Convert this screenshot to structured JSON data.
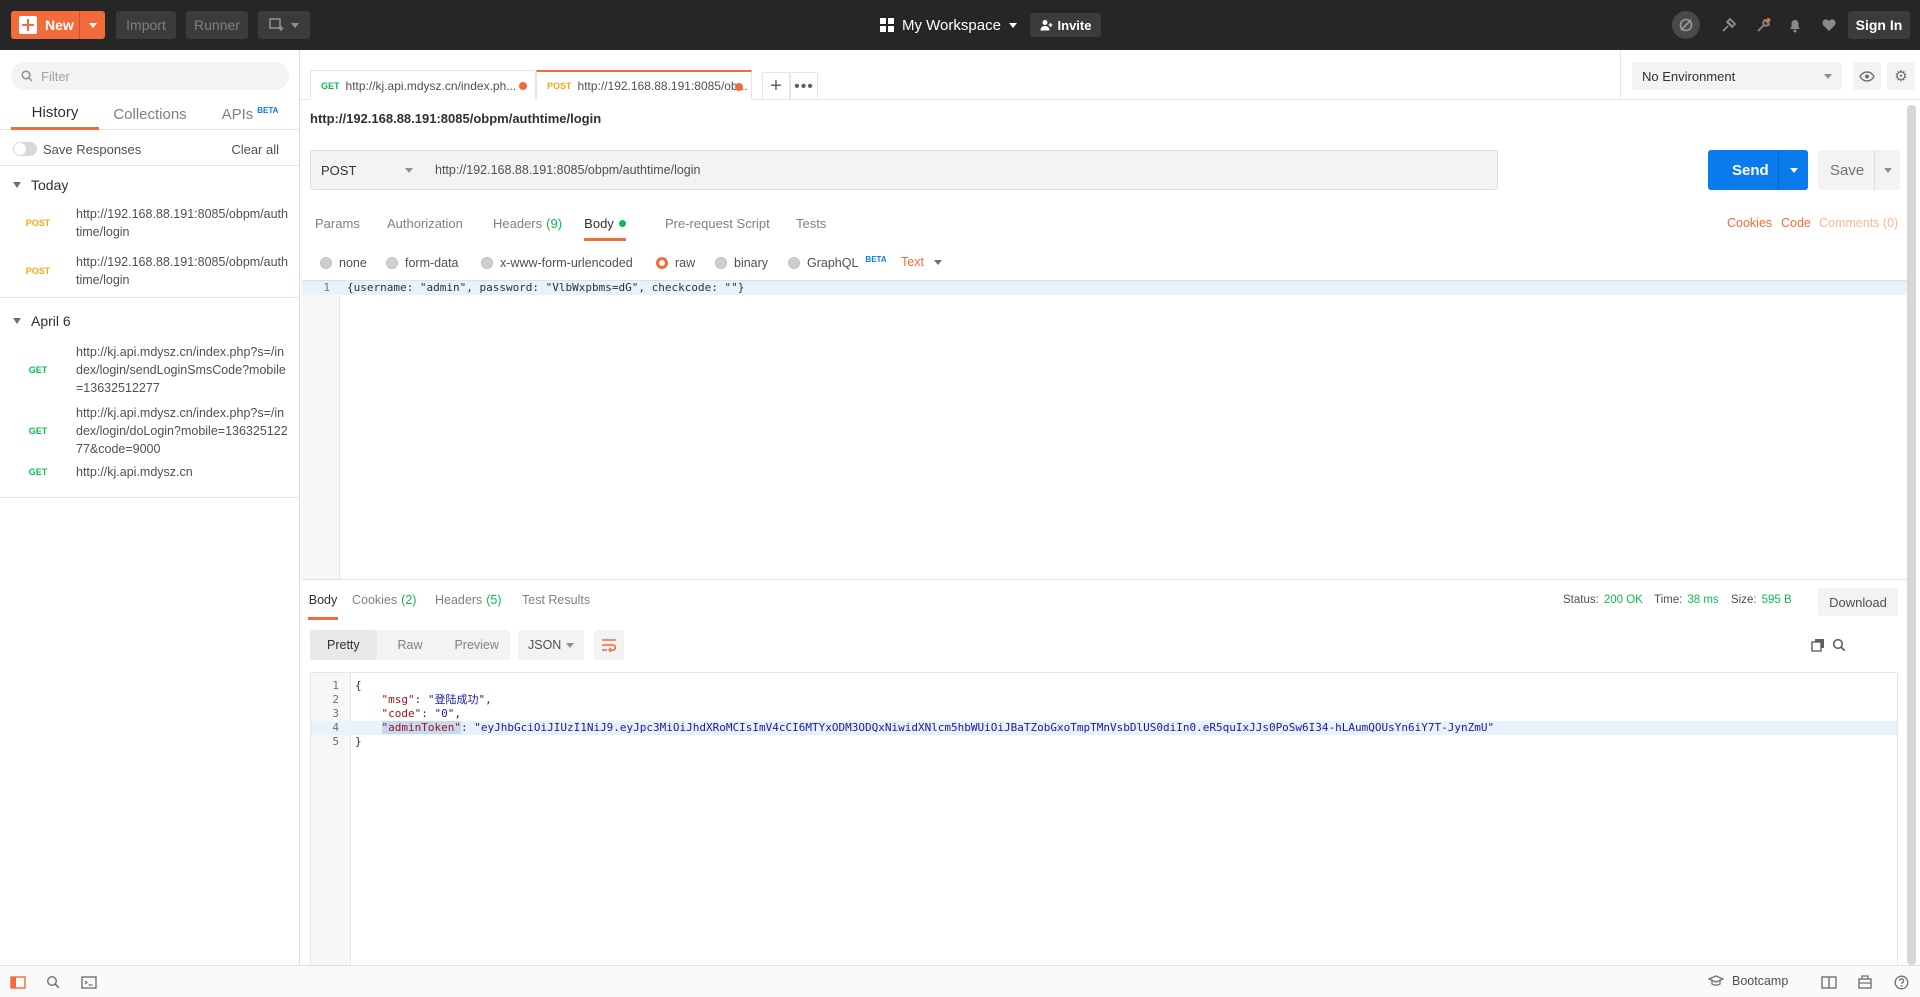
{
  "topbar": {
    "new_label": "New",
    "import_label": "Import",
    "runner_label": "Runner",
    "workspace_label": "My Workspace",
    "invite_label": "Invite",
    "signin_label": "Sign In"
  },
  "sidebar": {
    "filter_placeholder": "Filter",
    "tabs": [
      {
        "label": "History"
      },
      {
        "label": "Collections"
      },
      {
        "label": "APIs",
        "badge": "BETA"
      }
    ],
    "save_responses_label": "Save Responses",
    "clear_all_label": "Clear all",
    "groups": [
      {
        "label": "Today",
        "items": [
          {
            "method": "POST",
            "url": "http://192.168.88.191:8085/obpm/authtime/login"
          },
          {
            "method": "POST",
            "url": "http://192.168.88.191:8085/obpm/authtime/login"
          }
        ]
      },
      {
        "label": "April 6",
        "items": [
          {
            "method": "GET",
            "url": "http://kj.api.mdysz.cn/index.php?s=/index/login/sendLoginSmsCode?mobile=13632512277"
          },
          {
            "method": "GET",
            "url": "http://kj.api.mdysz.cn/index.php?s=/index/login/doLogin?mobile=13632512277&code=9000"
          },
          {
            "method": "GET",
            "url": "http://kj.api.mdysz.cn"
          }
        ]
      }
    ]
  },
  "request_tabs": [
    {
      "method": "GET",
      "label": "http://kj.api.mdysz.cn/index.ph..."
    },
    {
      "method": "POST",
      "label": "http://192.168.88.191:8085/ob..."
    }
  ],
  "environment": {
    "selected": "No Environment"
  },
  "request": {
    "title": "http://192.168.88.191:8085/obpm/authtime/login",
    "method": "POST",
    "url": "http://192.168.88.191:8085/obpm/authtime/login",
    "send_label": "Send",
    "save_label": "Save",
    "tabs": {
      "params": "Params",
      "authorization": "Authorization",
      "headers": "Headers",
      "headers_count": "(9)",
      "body": "Body",
      "prerequest": "Pre-request Script",
      "tests": "Tests",
      "cookies": "Cookies",
      "code": "Code",
      "comments": "Comments (0)"
    },
    "body_types": {
      "none": "none",
      "form_data": "form-data",
      "urlencoded": "x-www-form-urlencoded",
      "raw": "raw",
      "binary": "binary",
      "graphql": "GraphQL",
      "graphql_badge": "BETA",
      "format": "Text"
    },
    "body_line_number": "1",
    "body_text": "{username: \"admin\", password: \"VlbWxpbms=dG\", checkcode: \"\"}"
  },
  "response": {
    "tabs": {
      "body": "Body",
      "cookies": "Cookies",
      "cookies_count": "(2)",
      "headers": "Headers",
      "headers_count": "(5)",
      "test_results": "Test Results"
    },
    "status_label": "Status:",
    "status_value": "200 OK",
    "time_label": "Time:",
    "time_value": "38 ms",
    "size_label": "Size:",
    "size_value": "595 B",
    "download_label": "Download",
    "views": {
      "pretty": "Pretty",
      "raw": "Raw",
      "preview": "Preview"
    },
    "format": "JSON",
    "lines": [
      {
        "n": "1",
        "text": "{"
      },
      {
        "n": "2",
        "key": "\"msg\"",
        "value": "\"登陆成功\","
      },
      {
        "n": "3",
        "key": "\"code\"",
        "value": "\"0\","
      },
      {
        "n": "4",
        "key": "\"adminToken\"",
        "value": "\"eyJhbGciOiJIUzI1NiJ9.eyJpc3MiOiJhdXRoMCIsImV4cCI6MTYxODM3ODQxNiwidXNlcm5hbWUiOiJBaTZobGxoTmpTMnVsbDlUS0diIn0.eR5quIxJJs0PoSw6I34-hLAumQOUsYn6iY7T-JynZmU\""
      },
      {
        "n": "5",
        "text": "}"
      }
    ]
  },
  "statusbar": {
    "bootcamp_label": "Bootcamp"
  }
}
